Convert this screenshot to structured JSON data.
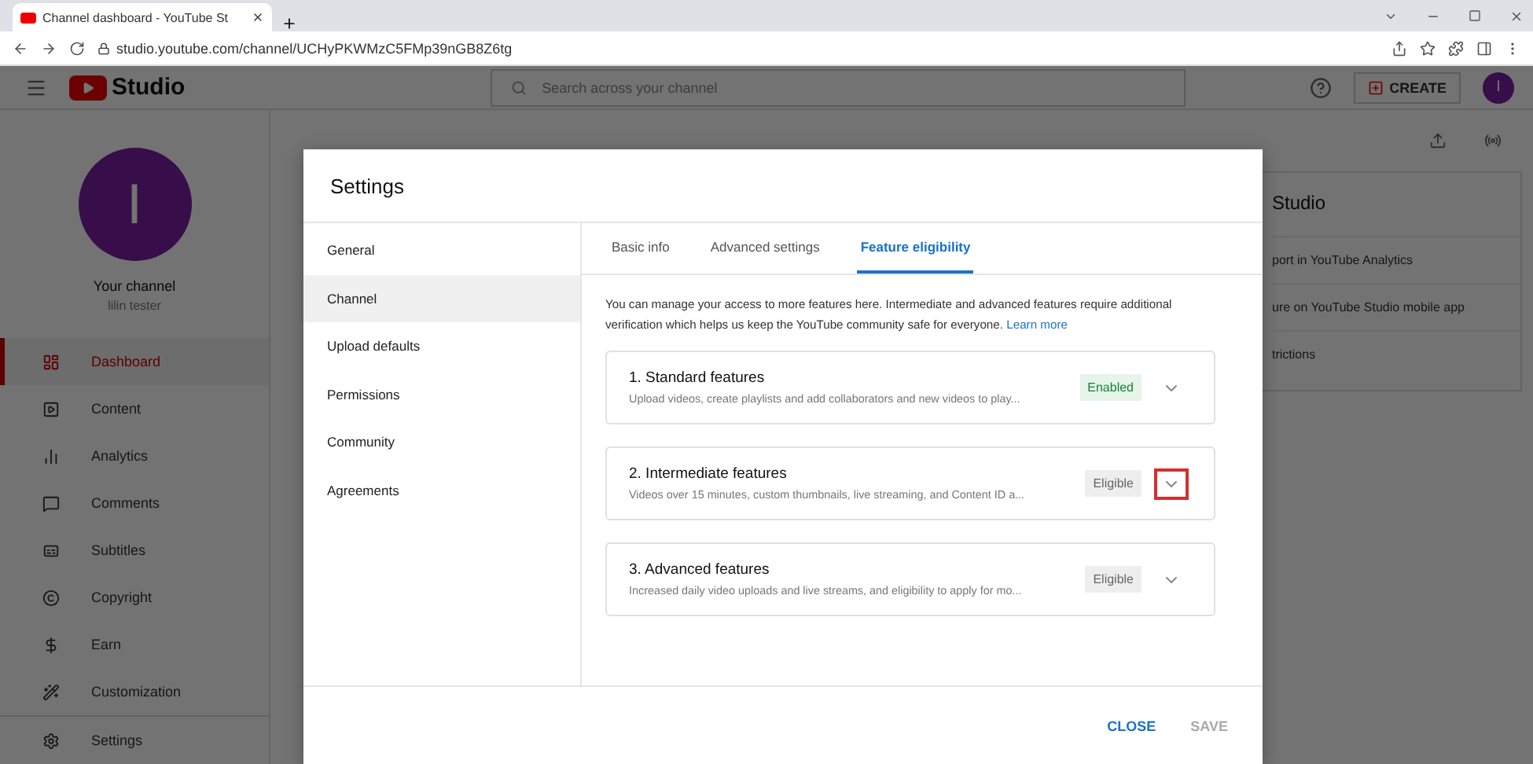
{
  "browser": {
    "tab_title": "Channel dashboard - YouTube St",
    "url": "studio.youtube.com/channel/UCHyPKWMzC5FMp39nGB8Z6tg"
  },
  "header": {
    "logo_text": "Studio",
    "search_placeholder": "Search across your channel",
    "create_label": "CREATE",
    "avatar_initial": "I"
  },
  "sidebar": {
    "avatar_initial": "I",
    "channel_title": "Your channel",
    "channel_name": "lilin tester",
    "items": [
      {
        "label": "Dashboard",
        "selected": true
      },
      {
        "label": "Content",
        "selected": false
      },
      {
        "label": "Analytics",
        "selected": false
      },
      {
        "label": "Comments",
        "selected": false
      },
      {
        "label": "Subtitles",
        "selected": false
      },
      {
        "label": "Copyright",
        "selected": false
      },
      {
        "label": "Earn",
        "selected": false
      },
      {
        "label": "Customization",
        "selected": false
      }
    ],
    "settings_label": "Settings"
  },
  "background_card": {
    "title": "Studio",
    "items": [
      "port in YouTube Analytics",
      "ure on YouTube Studio mobile app",
      "trictions"
    ]
  },
  "dialog": {
    "title": "Settings",
    "nav": [
      {
        "label": "General",
        "selected": false
      },
      {
        "label": "Channel",
        "selected": true
      },
      {
        "label": "Upload defaults",
        "selected": false
      },
      {
        "label": "Permissions",
        "selected": false
      },
      {
        "label": "Community",
        "selected": false
      },
      {
        "label": "Agreements",
        "selected": false
      }
    ],
    "tabs": [
      {
        "label": "Basic info",
        "selected": false
      },
      {
        "label": "Advanced settings",
        "selected": false
      },
      {
        "label": "Feature eligibility",
        "selected": true
      }
    ],
    "intro": "You can manage your access to more features here. Intermediate and advanced features require additional verification which helps us keep the YouTube community safe for everyone.",
    "intro_link": "Learn more",
    "features": [
      {
        "title": "1. Standard features",
        "description": "Upload videos, create playlists and add collaborators and new videos to play...",
        "status": "Enabled",
        "kind": "enabled",
        "highlighted": false
      },
      {
        "title": "2. Intermediate features",
        "description": "Videos over 15 minutes, custom thumbnails, live streaming, and Content ID a...",
        "status": "Eligible",
        "kind": "eligible",
        "highlighted": true
      },
      {
        "title": "3. Advanced features",
        "description": "Increased daily video uploads and live streams, and eligibility to apply for mo...",
        "status": "Eligible",
        "kind": "eligible",
        "highlighted": false
      }
    ],
    "buttons": [
      {
        "label": "CLOSE",
        "disabled": false
      },
      {
        "label": "SAVE",
        "disabled": true
      }
    ]
  }
}
